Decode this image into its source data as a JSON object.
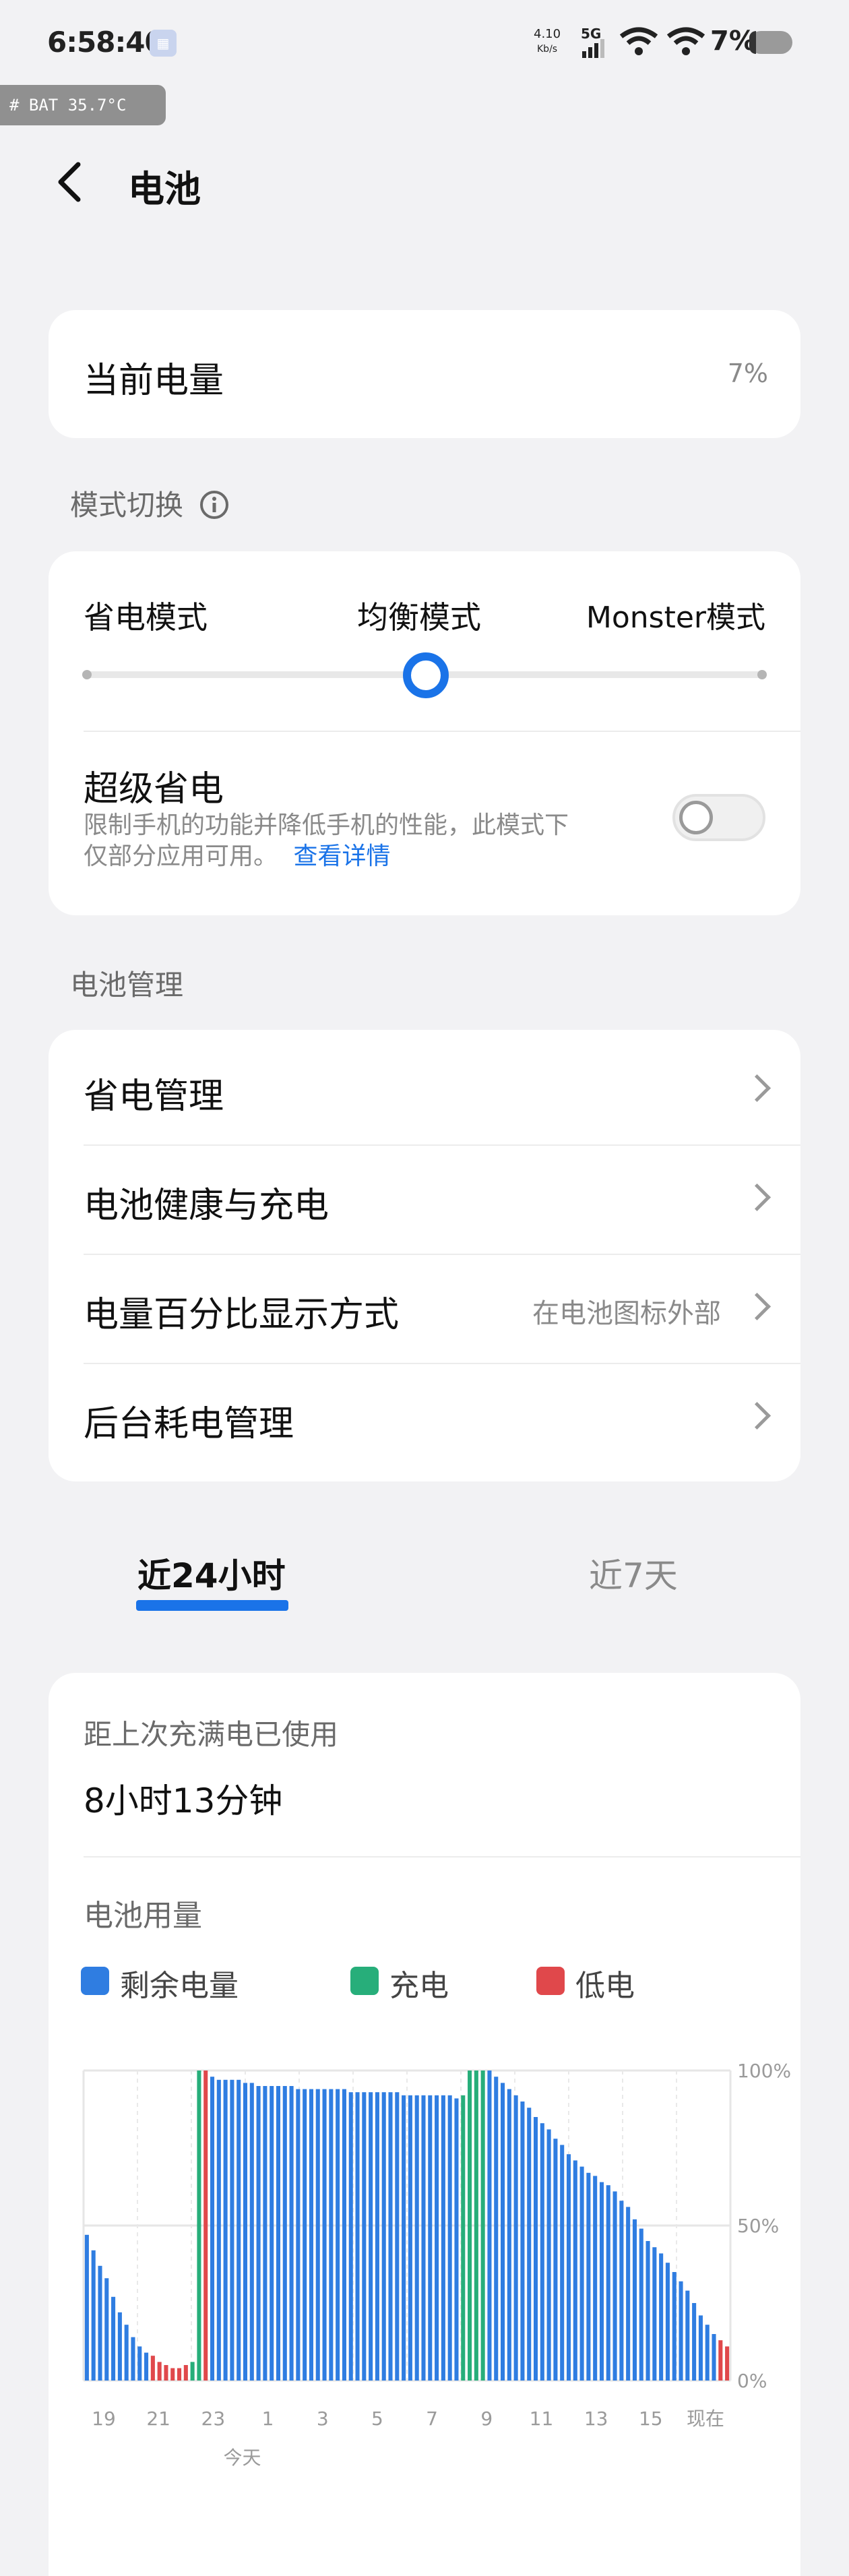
{
  "status_bar": {
    "time": "6:58:40",
    "speed_value": "4.10",
    "speed_unit": "Kb/s",
    "network": "5G",
    "battery_percent": "7%",
    "battery_temp": "# BAT 35.7°C"
  },
  "header": {
    "title": "电池"
  },
  "current_level": {
    "label": "当前电量",
    "value": "7%"
  },
  "mode_section": {
    "label": "模式切换",
    "modes": [
      "省电模式",
      "均衡模式",
      "Monster模式"
    ],
    "selected_index": 1,
    "super_save": {
      "title": "超级省电",
      "desc_line1": "限制手机的功能并降低手机的性能，此模式下",
      "desc_line2": "仅部分应用可用。",
      "link": "查看详情",
      "enabled": false
    }
  },
  "management": {
    "label": "电池管理",
    "items": [
      {
        "label": "省电管理",
        "value": ""
      },
      {
        "label": "电池健康与充电",
        "value": ""
      },
      {
        "label": "电量百分比显示方式",
        "value": "在电池图标外部"
      },
      {
        "label": "后台耗电管理",
        "value": ""
      }
    ]
  },
  "tabs": {
    "active": "近24小时",
    "inactive": "近7天"
  },
  "usage": {
    "since_full_label": "距上次充满电已使用",
    "since_full_value": "8小时13分钟",
    "usage_label": "电池用量",
    "legend": [
      {
        "label": "剩余电量",
        "color": "#2f7de1"
      },
      {
        "label": "充电",
        "color": "#27ae7a"
      },
      {
        "label": "低电",
        "color": "#e0484b"
      }
    ]
  },
  "chart_data": {
    "type": "bar",
    "y_ticks": [
      "100%",
      "50%",
      "0%"
    ],
    "ylim": [
      0,
      100
    ],
    "x_ticks": [
      "19",
      "21",
      "23",
      "1",
      "3",
      "5",
      "7",
      "9",
      "11",
      "13",
      "15",
      "现在"
    ],
    "x_sublabel": "今天",
    "grid": true,
    "series": [
      {
        "name": "剩余电量",
        "color": "#2f7de1",
        "values": [
          47,
          42,
          37,
          33,
          27,
          22,
          18,
          14,
          11,
          9,
          8,
          6,
          5,
          4,
          4,
          5,
          6,
          100,
          100,
          98,
          97,
          97,
          97,
          97,
          96,
          96,
          95,
          95,
          95,
          95,
          95,
          95,
          94,
          94,
          94,
          94,
          94,
          94,
          94,
          94,
          93,
          93,
          93,
          93,
          93,
          93,
          93,
          93,
          92,
          92,
          92,
          92,
          92,
          92,
          92,
          92,
          91,
          92,
          100,
          100,
          100,
          100,
          98,
          96,
          94,
          92,
          90,
          88,
          85,
          83,
          81,
          78,
          76,
          73,
          71,
          69,
          67,
          66,
          64,
          63,
          61,
          58,
          56,
          52,
          49,
          45,
          43,
          41,
          38,
          35,
          32,
          29,
          25,
          21,
          18,
          15,
          13,
          11
        ]
      },
      {
        "name": "充电",
        "color": "#27ae7a",
        "values": []
      },
      {
        "name": "低电",
        "color": "#e0484b",
        "values": []
      }
    ],
    "bar_colors": "bbbbbbbbbbrrrrrrrrrbbbbbbbbbbbbbbbbbbbbbbbbbbbbbbbbbbbbbbbbbbbbbbbbbbbbbbbbbbbbbbbbbbbbbbbbbbbbbrrrr"
  }
}
